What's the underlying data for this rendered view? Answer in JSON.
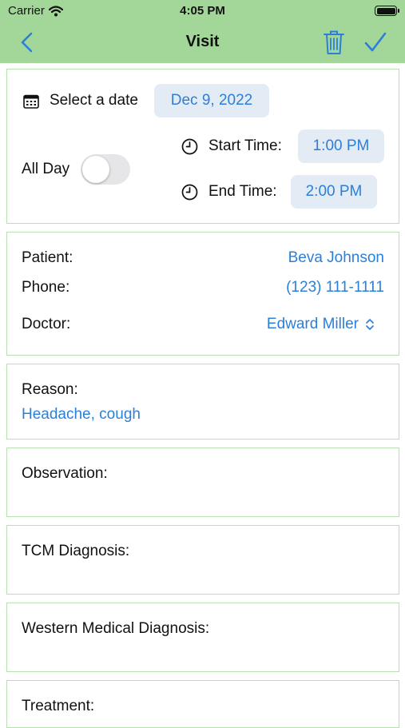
{
  "status_bar": {
    "carrier": "Carrier",
    "time": "4:05 PM"
  },
  "nav": {
    "title": "Visit"
  },
  "schedule": {
    "date_label": "Select a date",
    "date_value": "Dec 9, 2022",
    "all_day_label": "All Day",
    "all_day_on": false,
    "start_label": "Start Time:",
    "start_value": "1:00 PM",
    "end_label": "End Time:",
    "end_value": "2:00 PM"
  },
  "patient_info": {
    "patient_label": "Patient:",
    "patient_value": "Beva Johnson",
    "phone_label": "Phone:",
    "phone_value": "(123) 111-1111",
    "doctor_label": "Doctor:",
    "doctor_value": "Edward Miller"
  },
  "reason": {
    "label": "Reason:",
    "value": "Headache, cough"
  },
  "observation": {
    "label": "Observation:"
  },
  "tcm": {
    "label": "TCM Diagnosis:"
  },
  "western": {
    "label": "Western Medical Diagnosis:"
  },
  "treatment": {
    "label": "Treatment:"
  },
  "colors": {
    "nav_bg": "#a3d79a",
    "accent": "#2c7fd9",
    "card_border": "#b9e0b3",
    "pill_bg": "#e3ebf5"
  }
}
